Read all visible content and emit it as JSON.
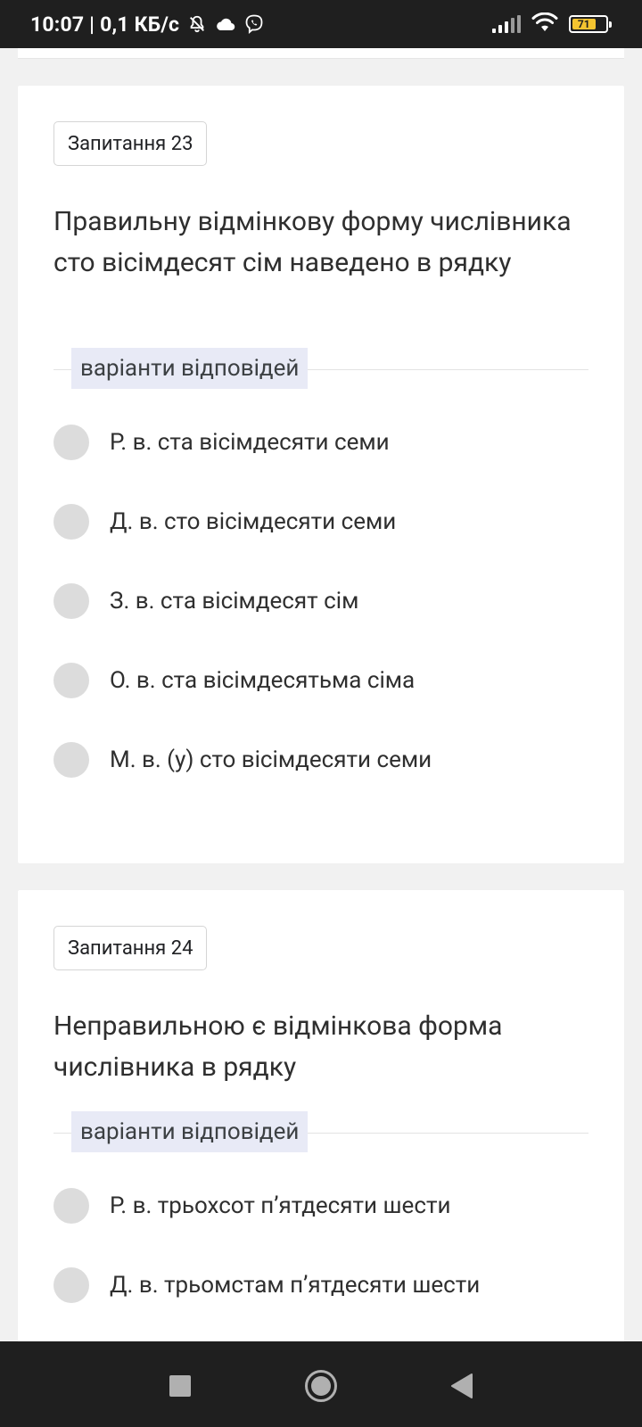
{
  "status_bar": {
    "time_and_speed": "10:07 | 0,1 КБ/с",
    "battery_level": "71",
    "icons": [
      "bell-off-icon",
      "cloud-icon",
      "viber-icon",
      "signal-icon",
      "wifi-icon",
      "battery-icon"
    ]
  },
  "questions": [
    {
      "badge": "Запитання 23",
      "text": "Правильну відмінкову форму числівника сто вісімдесят сім наведено в рядку",
      "variants_label": "варіанти відповідей",
      "options": [
        "Р. в. ста вісімдесяти семи",
        "Д. в. сто вісімдесяти семи",
        "З. в. ста вісімдесят сім",
        "О. в. ста вісімдесятьма сіма",
        "М. в. (у) сто вісімдесяти семи"
      ]
    },
    {
      "badge": "Запитання 24",
      "text": "Неправильною є відмінкова форма числівника в рядку",
      "variants_label": "варіанти відповідей",
      "options": [
        "Р. в. трьохсот п’ятдесяти шести",
        "Д. в. трьомстам п’ятдесяти шести"
      ]
    }
  ],
  "nav_bar": {
    "buttons": [
      "recents-square-icon",
      "home-circle-icon",
      "back-triangle-icon"
    ]
  },
  "colors": {
    "status_bar_bg": "#1f1f1f",
    "page_bg": "#f1f1f1",
    "card_bg": "#ffffff",
    "variants_label_bg": "#e8eaf6",
    "radio_fill": "#dcdcdc",
    "battery_fill": "#f4c430"
  }
}
